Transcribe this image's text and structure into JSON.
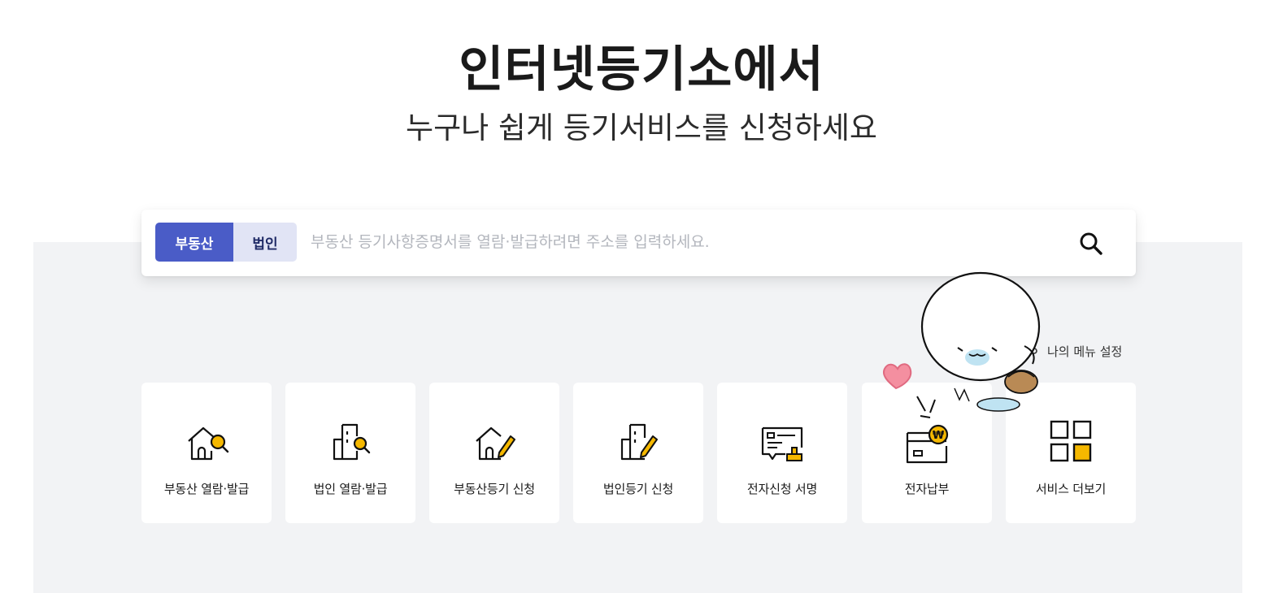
{
  "hero": {
    "title": "인터넷등기소에서",
    "subtitle": "누구나 쉽게 등기서비스를 신청하세요"
  },
  "search": {
    "tabs": [
      {
        "label": "부동산",
        "active": true
      },
      {
        "label": "법인",
        "active": false
      }
    ],
    "placeholder": "부동산 등기사항증명서를 열람·발급하려면 주소를 입력하세요.",
    "value": "",
    "button_icon": "search-icon"
  },
  "my_menu": {
    "label": "나의 메뉴 설정",
    "icon": "gear-icon"
  },
  "services": [
    {
      "label": "부동산 열람·발급",
      "icon": "house-search-icon"
    },
    {
      "label": "법인 열람·발급",
      "icon": "building-search-icon"
    },
    {
      "label": "부동산등기 신청",
      "icon": "house-pen-icon"
    },
    {
      "label": "법인등기 신청",
      "icon": "building-pen-icon"
    },
    {
      "label": "전자신청 서명",
      "icon": "document-stamp-icon"
    },
    {
      "label": "전자납부",
      "icon": "wallet-won-icon"
    },
    {
      "label": "서비스 더보기",
      "icon": "grid-more-icon"
    }
  ],
  "colors": {
    "accent": "#4a5cc7",
    "accent_light": "#e1e4f5",
    "icon_highlight": "#f5b800",
    "background_gray": "#f2f3f5"
  }
}
